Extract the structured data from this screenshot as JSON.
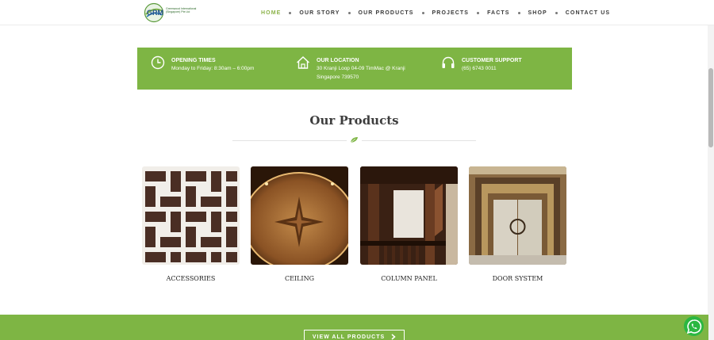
{
  "header": {
    "logo_text_1": "Greenwood International",
    "logo_text_2": "(Singapore) Pte Ltd",
    "logo_mark": "GRM",
    "nav": [
      "HOME",
      "OUR STORY",
      "OUR PRODUCTS",
      "PROJECTS",
      "FACTS",
      "SHOP",
      "CONTACT US"
    ],
    "active_nav": "HOME"
  },
  "info": {
    "opening": {
      "icon": "clock-icon",
      "title": "OPENING TIMES",
      "lines": [
        "Monday to Friday: 8:30am – 6:00pm"
      ]
    },
    "location": {
      "icon": "home-icon",
      "title": "OUR LOCATION",
      "lines": [
        "30 Kranji Loop 04-09 TimMac @ Kranji",
        "Singapore 739570"
      ]
    },
    "support": {
      "icon": "headphones-icon",
      "title": "CUSTOMER SUPPORT",
      "lines": [
        "(65) 6743 0011"
      ]
    }
  },
  "products_section": {
    "title": "Our Products",
    "items": [
      {
        "name": "ACCESSORIES"
      },
      {
        "name": "CEILING"
      },
      {
        "name": "COLUMN PANEL"
      },
      {
        "name": "DOOR SYSTEM"
      }
    ],
    "view_all": "VIEW ALL PRODUCTS"
  },
  "colors": {
    "accent_green": "#7eb544",
    "active_nav": "#8cb34a",
    "whatsapp": "#2bb741"
  }
}
